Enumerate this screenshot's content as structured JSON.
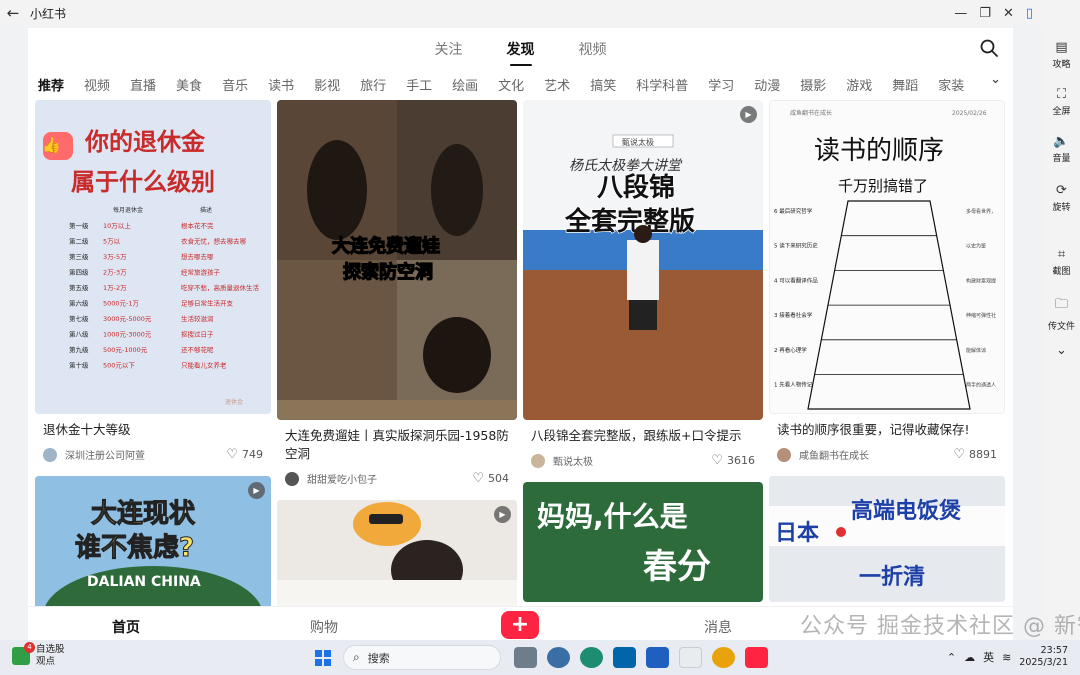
{
  "titlebar": {
    "back_icon": "back-arrow-icon",
    "title": "小红书"
  },
  "top_tabs": [
    {
      "label": "关注",
      "active": false
    },
    {
      "label": "发现",
      "active": true
    },
    {
      "label": "视频",
      "active": false
    }
  ],
  "categories": [
    "推荐",
    "视频",
    "直播",
    "美食",
    "音乐",
    "读书",
    "影视",
    "旅行",
    "手工",
    "绘画",
    "文化",
    "艺术",
    "搞笑",
    "科学科普",
    "学习",
    "动漫",
    "摄影",
    "游戏",
    "舞蹈",
    "家装"
  ],
  "feed": {
    "col1": [
      {
        "title": "退休金十大等级",
        "author": "深圳注册公司阿萱",
        "likes": "749",
        "cover": {
          "headline1": "你的退休金",
          "headline2": "属于什么级别",
          "col_head1": "每月退休金",
          "col_head2": "描述",
          "rows": [
            [
              "第一级",
              "10万以上",
              "根本花不完"
            ],
            [
              "第二级",
              "5万以",
              "衣食无忧，想去哪去哪"
            ],
            [
              "第三级",
              "3万-5万",
              "想去哪去哪"
            ],
            [
              "第四级",
              "2万-3万",
              "经常旅游孩子"
            ],
            [
              "第五级",
              "1万-2万",
              "吃穿不愁，高质量退休生活"
            ],
            [
              "第六级",
              "5000元-1万",
              "足够日常生活开支"
            ],
            [
              "第七级",
              "3000元-5000元",
              "生活较滋润"
            ],
            [
              "第八级",
              "1000元-3000元",
              "抠搜过日子"
            ],
            [
              "第九级",
              "500元-1000元",
              "还不够花呢"
            ],
            [
              "第十级",
              "500元以下",
              "只能看儿女养老"
            ]
          ],
          "footer": "退休金"
        }
      },
      {
        "cover": {
          "line1": "大连现状",
          "line2": "谁不焦虑?",
          "arc": "DALIAN  CHINA"
        }
      }
    ],
    "col2": [
      {
        "title": "大连免费遛娃丨真实版探洞乐园-1958防空洞",
        "author": "甜甜爱吃小包子",
        "likes": "504",
        "cover": {
          "line1": "大连免费遛娃",
          "line2": "探索防空洞"
        }
      },
      {
        "cover": {}
      }
    ],
    "col3": [
      {
        "title": "八段锦全套完整版，跟练版+口令提示",
        "author": "甄说太极",
        "likes": "3616",
        "cover": {
          "banner": "杨氏太极拳大讲堂",
          "logo": "甄说太极",
          "line1": "八段锦",
          "line2": "全套完整版"
        }
      },
      {
        "cover": {
          "line1": "妈妈,什么是",
          "line2": "春分"
        }
      }
    ],
    "col4": [
      {
        "title": "读书的顺序很重要，记得收藏保存!",
        "author": "咸鱼翻书在成长",
        "likes": "8891",
        "cover": {
          "header_left": "咸鱼翻书在成长",
          "header_right": "2025/02/26",
          "line1": "读书的顺序",
          "line2": "千万别搞错了",
          "steps": [
            "6 最后研究哲学",
            "5 读下来研究历史",
            "4 可以看翻译作品",
            "3 接着看社会学",
            "2 再看心理学",
            "1 先看人物传记"
          ],
          "notes": [
            "多母看世界，修思考成人之",
            "以史为鉴",
            "构建财富观提升解惑思维",
            "伸缩可弹性社会深运",
            "能解体谅",
            "两手的通透人生"
          ]
        }
      },
      {
        "cover": {
          "line1": "日本",
          "line2": "高端电饭煲",
          "line3": "一折清"
        }
      }
    ]
  },
  "bottom_nav": [
    {
      "label": "首页",
      "active": true
    },
    {
      "label": "购物",
      "active": false
    },
    {
      "label": "+",
      "active": false
    },
    {
      "label": "消息",
      "active": false
    }
  ],
  "right_sidebar": [
    {
      "label": "攻略",
      "icon": "book-icon"
    },
    {
      "label": "全屏",
      "icon": "fullscreen-icon"
    },
    {
      "label": "音量",
      "icon": "volume-icon"
    },
    {
      "label": "旋转",
      "icon": "rotate-icon"
    },
    {
      "label": "截图",
      "icon": "crop-icon"
    },
    {
      "label": "传文件",
      "icon": "folder-icon"
    },
    {
      "label": "",
      "icon": "chevron-down-icon"
    }
  ],
  "watermark": "掘金技术社区 @ 新智元",
  "watermark_prefix": "公众号",
  "taskbar": {
    "stock_badge": "4",
    "stock_title": "自选股",
    "stock_sub": "观点",
    "search_placeholder": "搜索",
    "ime": "英",
    "time": "23:57",
    "date": "2025/3/21"
  },
  "colors": {
    "brand_red": "#ff2442",
    "text_primary": "#222222",
    "text_secondary": "#666666"
  }
}
